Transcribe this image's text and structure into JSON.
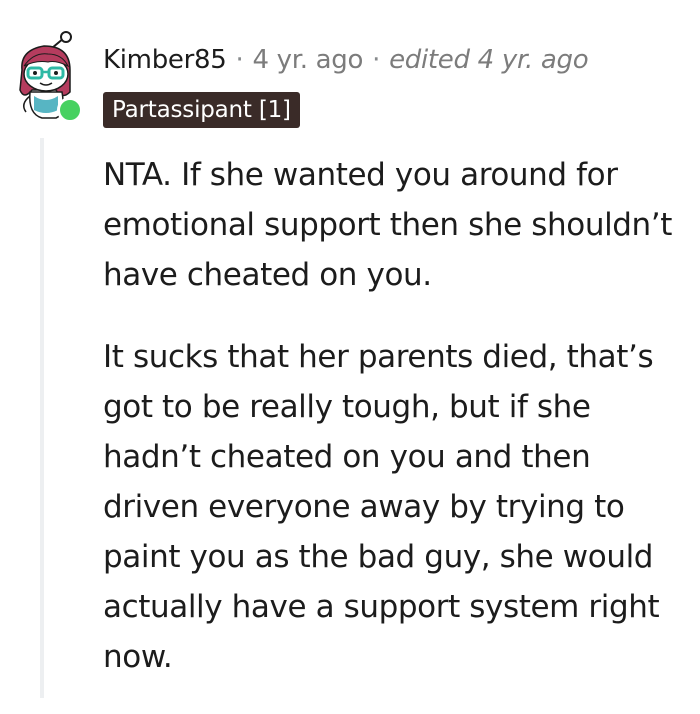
{
  "comment": {
    "author": "Kimber85",
    "separator": "·",
    "time": "4 yr. ago",
    "edited": "edited 4 yr. ago",
    "flair": "Partassipant [1]",
    "paragraphs": [
      "NTA. If she wanted you around for emotional support then she shouldn’t have cheated on you.",
      "It sucks that her parents died, that’s got to be really tough, but if she hadn’t cheated on you and then driven everyone away by trying to paint you as the bad guy, she would actually have a support system right now."
    ]
  },
  "colors": {
    "online": "#46d160",
    "flair_bg": "#3a2b28",
    "avatar_hair": "#b53c5e",
    "avatar_glasses": "#2fb9a5"
  },
  "icons": {
    "avatar": "snoo-avatar-icon",
    "online": "online-status-icon"
  }
}
